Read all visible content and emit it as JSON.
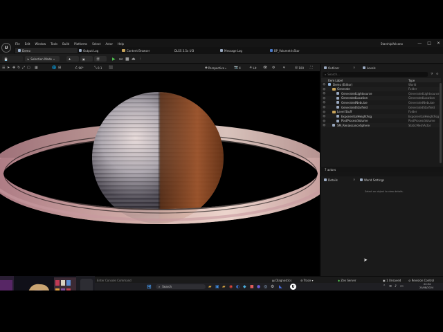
{
  "app": {
    "logo_text": "U",
    "project_name": "StarshipVolcano",
    "menu": [
      "File",
      "Edit",
      "Window",
      "Tools",
      "Build",
      "Platforms",
      "Select",
      "Actor",
      "Help"
    ],
    "window_controls": [
      "—",
      "□",
      "✕"
    ]
  },
  "tabs": {
    "level": "Demo",
    "others": [
      "Output Log",
      "Content Browser",
      "DLSS 3.5x UI3",
      "Message Log",
      "BP_VolumetricStar"
    ]
  },
  "toolbar": {
    "mode": "Selection Mode",
    "play_icons": [
      "▶",
      "⏭",
      "■",
      "⏏"
    ]
  },
  "viewport_toolbar": {
    "angle": "90°",
    "snap": "0.1",
    "view_mode": "Perspective",
    "lit": "Lit",
    "speed": "4",
    "fov": "100"
  },
  "outliner": {
    "tab_outliner": "Outliner",
    "tab_levels": "Levels",
    "search_placeholder": "Search...",
    "col_item": "Item Label",
    "col_type": "Type",
    "rows": [
      {
        "name": "Demo (Editor)",
        "type": "World",
        "indent": 0,
        "kind": "world"
      },
      {
        "name": "Generate",
        "type": "Folder",
        "indent": 1,
        "kind": "folder"
      },
      {
        "name": "GeneratedLightsource",
        "type": "GeneratedLightsource",
        "indent": 2,
        "kind": "actor"
      },
      {
        "name": "GeneratedLocation",
        "type": "GeneratedLocation",
        "indent": 2,
        "kind": "actor"
      },
      {
        "name": "GeneratedNebulae",
        "type": "GeneratedNebulae",
        "indent": 2,
        "kind": "actor"
      },
      {
        "name": "GeneratedStarfield",
        "type": "GeneratedStarfield",
        "indent": 2,
        "kind": "actor"
      },
      {
        "name": "Level Stuff",
        "type": "Folder",
        "indent": 1,
        "kind": "folder"
      },
      {
        "name": "ExponentialHeightFog",
        "type": "ExponentialHeightFog",
        "indent": 2,
        "kind": "actor"
      },
      {
        "name": "PostProcessVolume",
        "type": "PostProcessVolume",
        "indent": 2,
        "kind": "actor"
      },
      {
        "name": "SM_RenaissanceSphere",
        "type": "StaticMeshActor",
        "indent": 1,
        "kind": "actor"
      }
    ],
    "footer": "7 actors"
  },
  "details": {
    "tab_details": "Details",
    "tab_world": "World Settings",
    "empty": "Select an object to view details."
  },
  "statusbar": {
    "console": "Enter Console Command",
    "diagnostics": "Diagnostics",
    "trace": "Trace",
    "zen": "Zen Server",
    "unsaved": "1 Unsaved",
    "revision": "Revision Control"
  },
  "taskbar": {
    "search": "Search",
    "time": "22:34",
    "date": "20/08/2024"
  },
  "colors": {
    "accent": "#2f6fd0",
    "panel": "#1a1a1a",
    "viewport": "#000000"
  }
}
